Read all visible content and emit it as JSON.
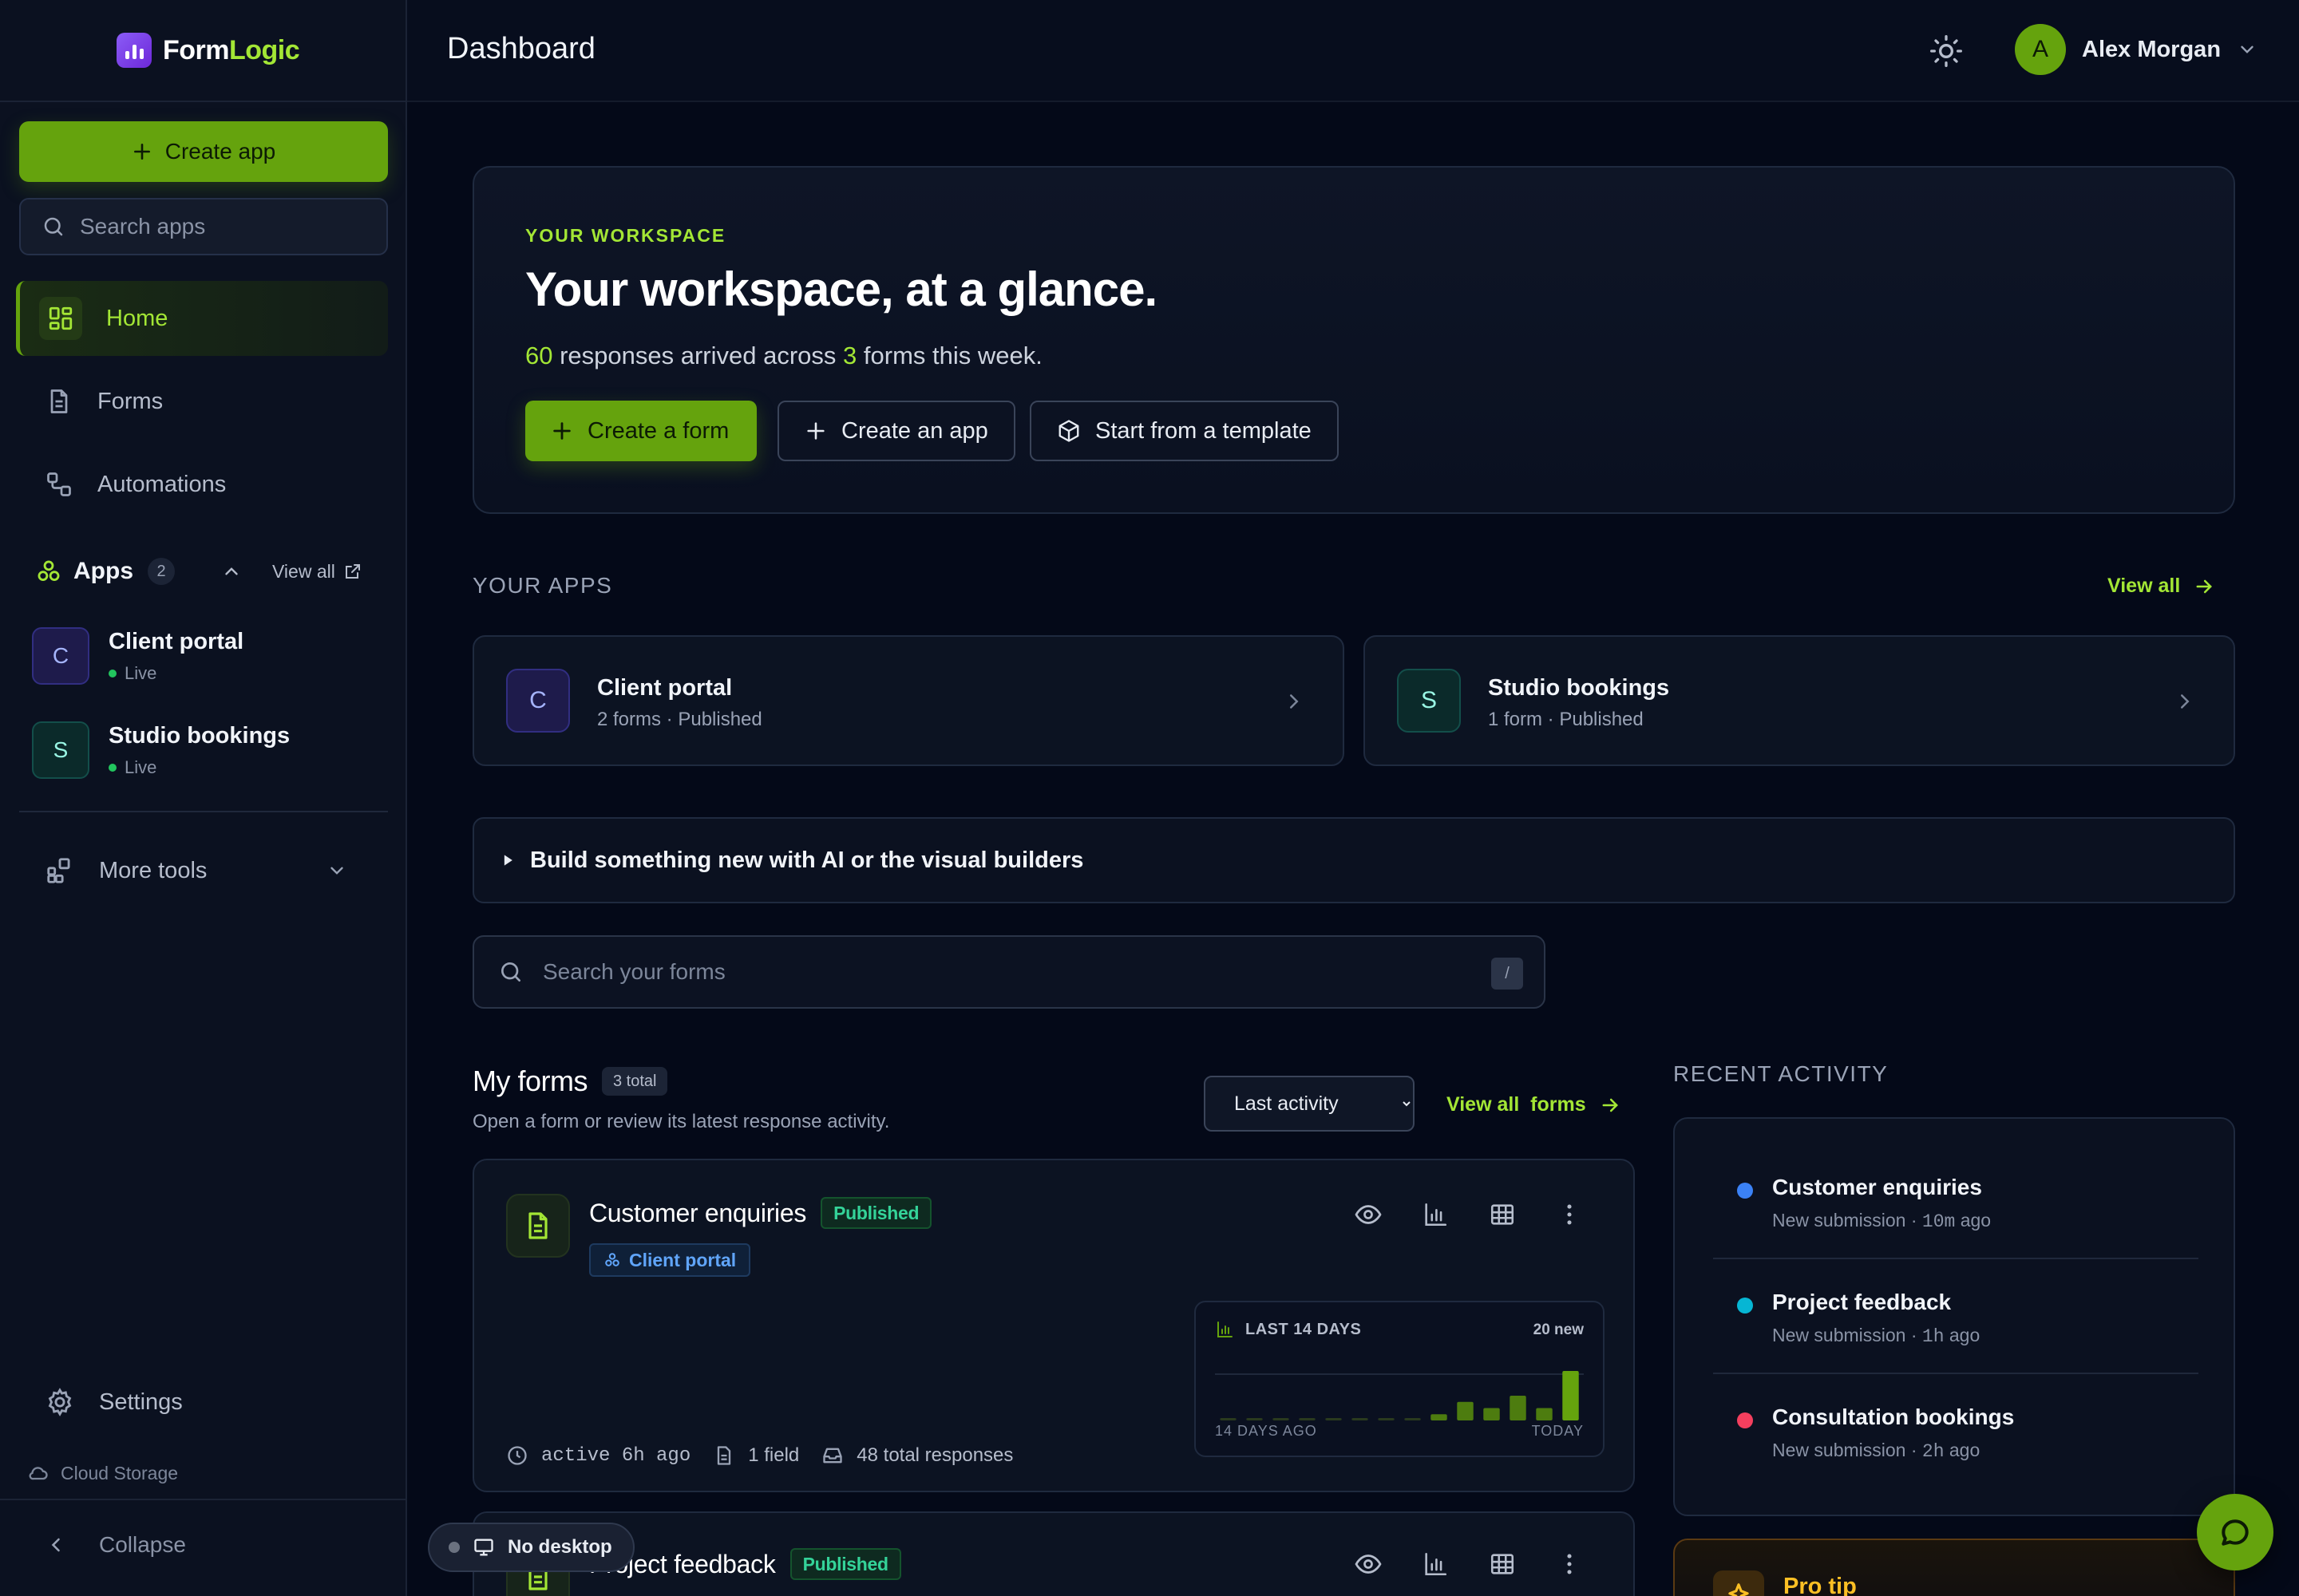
{
  "brand": {
    "name_a": "Form",
    "name_b": "Logic"
  },
  "sidebar": {
    "create_app_label": "Create app",
    "search_placeholder": "Search apps",
    "nav": [
      {
        "label": "Home",
        "icon": "grid-icon",
        "active": true
      },
      {
        "label": "Forms",
        "icon": "document-icon"
      },
      {
        "label": "Automations",
        "icon": "flow-icon"
      }
    ],
    "apps_title": "Apps",
    "apps_count": "2",
    "apps_view_all": "View all",
    "apps": [
      {
        "initial": "C",
        "name": "Client portal",
        "status": "Live"
      },
      {
        "initial": "S",
        "name": "Studio bookings",
        "status": "Live"
      }
    ],
    "more_tools": "More tools",
    "settings": "Settings",
    "cloud_storage": "Cloud Storage",
    "collapse": "Collapse"
  },
  "header": {
    "title": "Dashboard",
    "user_initial": "A",
    "user_name": "Alex Morgan"
  },
  "hero": {
    "eyebrow": "YOUR WORKSPACE",
    "headline": "Your workspace, at a glance.",
    "responses": "60",
    "sub_mid": " responses arrived across ",
    "forms": "3",
    "sub_end": " forms this week.",
    "btn_create_form": "Create a form",
    "btn_create_app": "Create an app",
    "btn_template": "Start from a template"
  },
  "your_apps": {
    "label": "YOUR APPS",
    "view_all": "View all",
    "items": [
      {
        "initial": "C",
        "name": "Client portal",
        "meta": "2 forms · Published"
      },
      {
        "initial": "S",
        "name": "Studio bookings",
        "meta": "1 form · Published"
      }
    ]
  },
  "builder_toggle": "Build something new with AI or the visual builders",
  "form_search": {
    "placeholder": "Search your forms",
    "shortcut": "/"
  },
  "my_forms": {
    "title": "My forms",
    "count": "3 total",
    "subtitle": "Open a form or review its latest response activity.",
    "sort_value": "Last activity",
    "view_all_a": "View all",
    "view_all_b": "forms",
    "cards": [
      {
        "name": "Customer enquiries",
        "status": "Published",
        "app": "Client portal",
        "active": "active 6h ago",
        "fields": "1 field",
        "responses": "48 total responses",
        "spark_title": "LAST 14 DAYS",
        "spark_new": "20 new",
        "spark_start": "14 DAYS AGO",
        "spark_end": "TODAY"
      },
      {
        "name": "Project feedback",
        "status": "Published"
      }
    ]
  },
  "chart_data": {
    "type": "bar",
    "title": "LAST 14 DAYS",
    "categories": [
      "14 DAYS AGO",
      "",
      "",
      "",
      "",
      "",
      "",
      "",
      "",
      "",
      "",
      "",
      "",
      "TODAY"
    ],
    "values": [
      0,
      0,
      0,
      0,
      0,
      0,
      0,
      0,
      1,
      3,
      2,
      4,
      2,
      5
    ],
    "highlight_values": [
      0,
      0,
      0,
      0,
      0,
      0,
      0,
      0,
      0,
      0,
      0,
      0,
      0,
      3
    ],
    "color": "#4d7c0f",
    "highlight_color": "#65a30d"
  },
  "recent_activity": {
    "label": "RECENT ACTIVITY",
    "items": [
      {
        "title": "Customer enquiries",
        "prefix": "New submission · ",
        "time": "10m",
        "suffix": " ago",
        "color": "#3b82f6"
      },
      {
        "title": "Project feedback",
        "prefix": "New submission · ",
        "time": "1h",
        "suffix": " ago",
        "color": "#06b6d4"
      },
      {
        "title": "Consultation bookings",
        "prefix": "New submission · ",
        "time": "2h",
        "suffix": " ago",
        "color": "#f43f5e"
      }
    ]
  },
  "pro_tip": "Pro tip",
  "desktop_status": "No desktop"
}
